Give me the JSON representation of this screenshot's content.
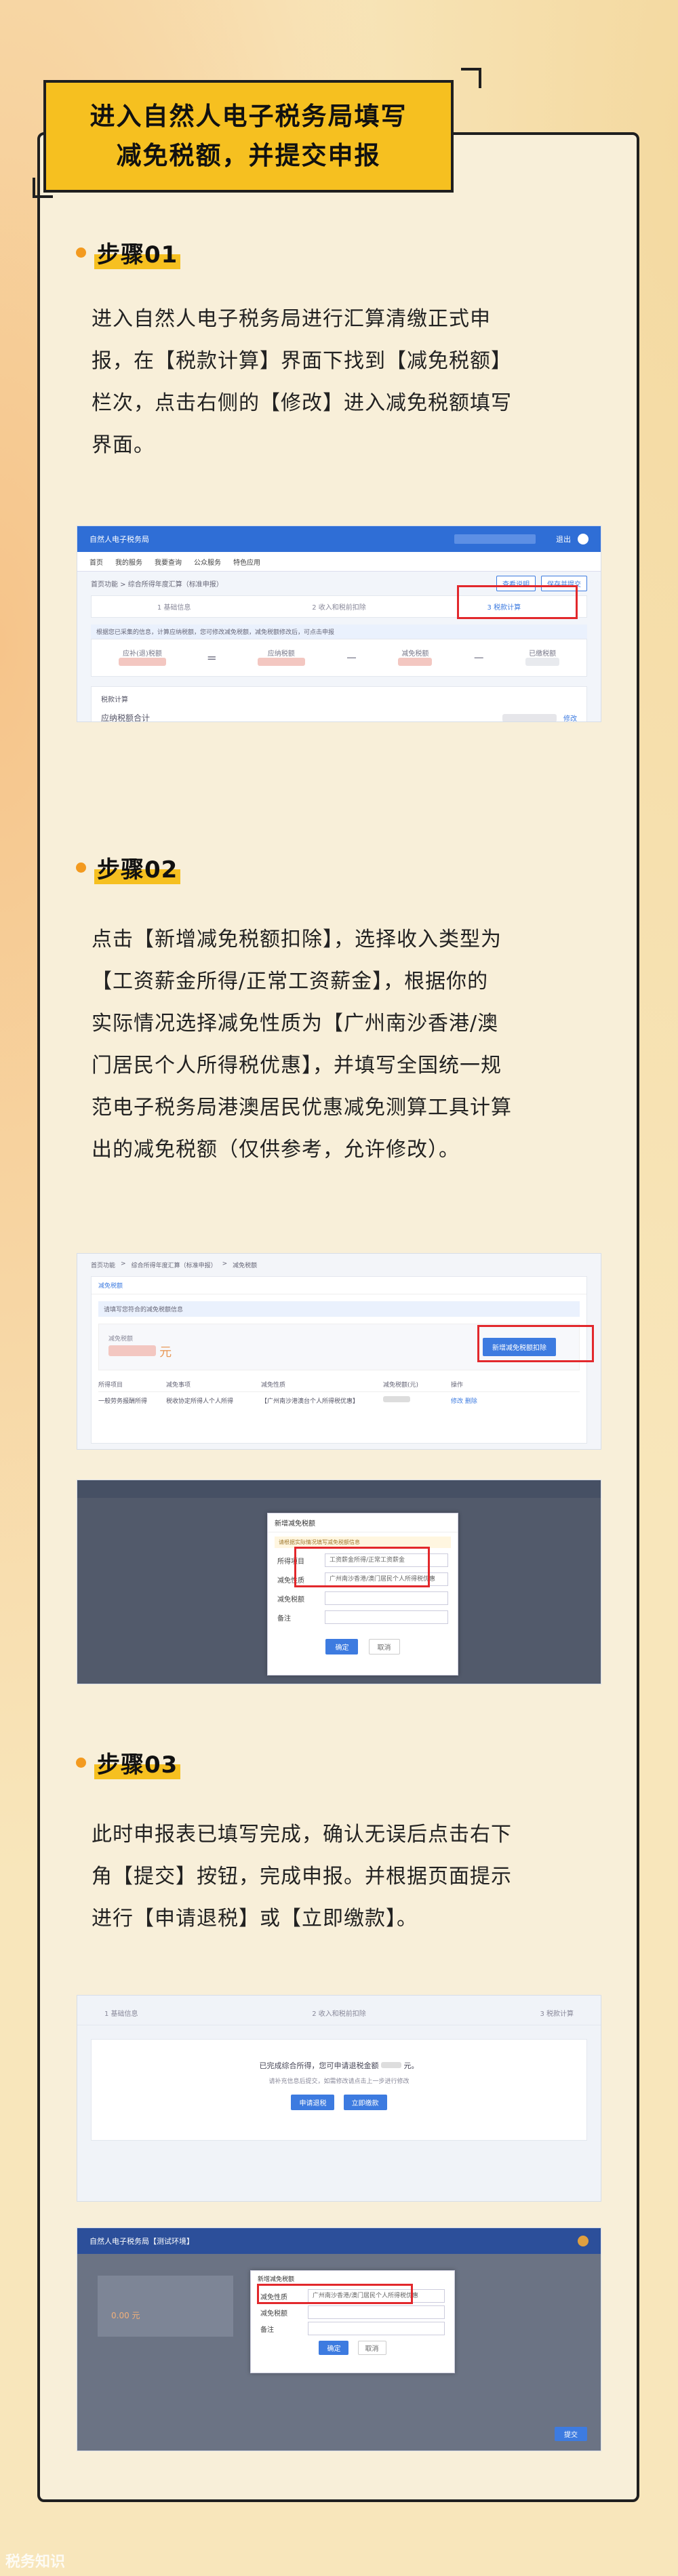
{
  "header": {
    "title_line1": "进入自然人电子税务局填写",
    "title_line2": "减免税额，并提交申报"
  },
  "steps": [
    {
      "label": "步骤01",
      "text": "进入自然人电子税务局进行汇算清缴正式申\n报，在【税款计算】界面下找到【减免税额】\n栏次，点击右侧的【修改】进入减免税额填写\n界面。"
    },
    {
      "label": "步骤02",
      "text": "点击【新增减免税额扣除】，选择收入类型为\n【工资薪金所得/正常工资薪金】，根据你的\n实际情况选择减免性质为【广州南沙香港/澳\n门居民个人所得税优惠】，并填写全国统一规\n范电子税务局港澳居民优惠减免测算工具计算\n出的减免税额（仅供参考，允许修改）。"
    },
    {
      "label": "步骤03",
      "text": "此时申报表已填写完成，确认无误后点击右下\n角【提交】按钮，完成申报。并根据页面提示\n进行【申请退税】或【立即缴款】。"
    }
  ],
  "shot1": {
    "app_title": "自然人电子税务局",
    "nav": [
      "首页",
      "我的服务",
      "我要查询",
      "公众服务",
      "特色应用"
    ],
    "user": "退出",
    "crumb": "首页功能 > 综合所得年度汇算（标准申报）",
    "btn1": "查看说明",
    "btn2": "保存并提交",
    "tabs": [
      "1 基础信息",
      "2 收入和税前扣除",
      "3 税款计算"
    ],
    "notice": "根据您已采集的信息，计算应纳税额，您可修改减免税额，减免税额修改后，可点击申报",
    "calc_labels": [
      "应补(退)税额",
      "应纳税额",
      "减免税额",
      "已缴税额"
    ],
    "ops": [
      "=",
      "－",
      "－"
    ],
    "section": "税款计算",
    "row_label": "应纳税额合计",
    "modify": "修改"
  },
  "shot2": {
    "crumb_items": [
      "首页功能",
      "综合所得年度汇算（标准申报）",
      "减免税额"
    ],
    "tab": "减免税额",
    "notice": "请填写您符合的减免税额信息",
    "amount_label": "减免税额",
    "amount_unit": "元",
    "add_btn": "新增减免税额扣除",
    "headers": [
      "所得项目",
      "减免事项",
      "减免性质",
      "减免税额(元)",
      "操作"
    ],
    "row": [
      "一般劳务报酬所得",
      "税收协定所得人个人所得",
      "【广州南沙港澳台个人所得税优惠】",
      "",
      "修改 删除"
    ]
  },
  "shot3": {
    "modal_title": "新增减免税额",
    "notice": "请根据实际情况填写减免税额信息",
    "fields": [
      {
        "k": "所得项目",
        "v": "工资薪金所得/正常工资薪金"
      },
      {
        "k": "减免性质",
        "v": "广州南沙香港/澳门居民个人所得税优惠"
      },
      {
        "k": "减免税额",
        "v": ""
      },
      {
        "k": "备注",
        "v": ""
      }
    ],
    "ok": "确定",
    "cancel": "取消"
  },
  "shot4": {
    "steps": [
      "1 基础信息",
      "2 收入和税前扣除",
      "3 税款计算"
    ],
    "line1": "已完成综合所得，您可申请退税金额",
    "unit": "元。",
    "line2": "请补充信息后提交，如需修改请点击上一步进行修改",
    "btn_refund": "申请退税",
    "btn_pay": "立即缴款"
  },
  "shot5": {
    "app_title": "自然人电子税务局【测试环境】",
    "modal_title": "新增减免税额",
    "fields": [
      {
        "k": "减免性质",
        "v": "广州南沙香港/澳门居民个人所得税优惠"
      },
      {
        "k": "减免税额",
        "v": ""
      },
      {
        "k": "备注",
        "v": ""
      }
    ],
    "ok": "确定",
    "cancel": "取消",
    "amount": "0.00 元",
    "submit": "提交"
  },
  "watermark": "税务知识"
}
